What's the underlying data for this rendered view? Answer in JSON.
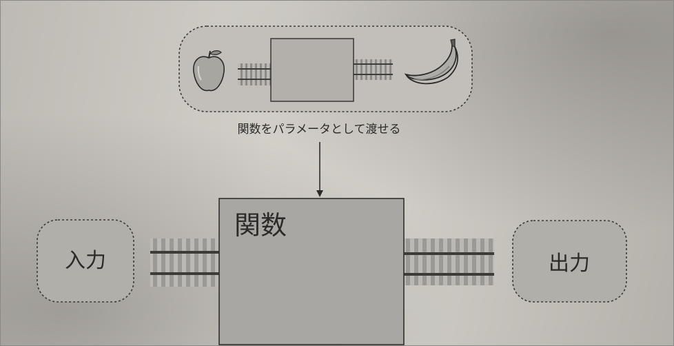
{
  "diagram": {
    "caption": "関数をパラメータとして渡せる",
    "function_label": "関数",
    "input_label": "入力",
    "output_label": "出力",
    "top_input_icon": "apple-icon",
    "top_output_icon": "banana-icon"
  },
  "colors": {
    "box_fill": "#a9a7a3",
    "rounded_fill": "#b1afaa",
    "dotted_border": "#3a3936",
    "rail": "#3e3c39",
    "tie": "#9b9995"
  }
}
